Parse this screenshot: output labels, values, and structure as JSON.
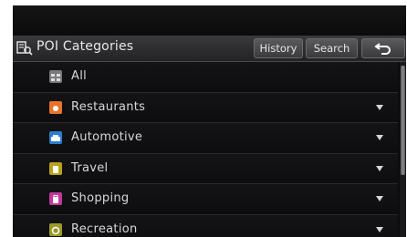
{
  "header": {
    "title": "POI Categories",
    "history_label": "History",
    "search_label": "Search"
  },
  "categories": [
    {
      "label": "All",
      "icon": "all-icon",
      "color": "#8a8a8a",
      "expandable": false
    },
    {
      "label": "Restaurants",
      "icon": "restaurant-icon",
      "color": "#e8742a",
      "expandable": true
    },
    {
      "label": "Automotive",
      "icon": "car-icon",
      "color": "#2a7fd0",
      "expandable": true
    },
    {
      "label": "Travel",
      "icon": "travel-icon",
      "color": "#b8a21a",
      "expandable": true
    },
    {
      "label": "Shopping",
      "icon": "shopping-icon",
      "color": "#c03a9a",
      "expandable": true
    },
    {
      "label": "Recreation",
      "icon": "recreation-icon",
      "color": "#9a9a2a",
      "expandable": true
    }
  ]
}
